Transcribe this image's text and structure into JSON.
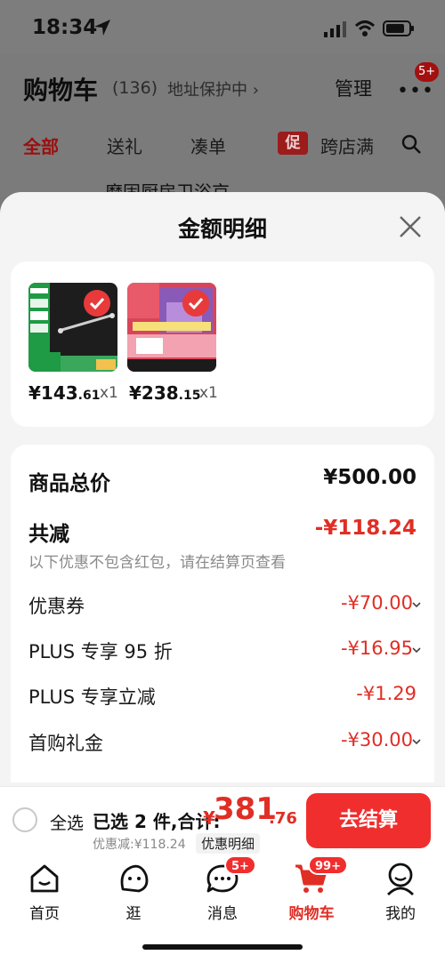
{
  "status_bar": {
    "time": "18:34"
  },
  "cart_header": {
    "title": "购物车",
    "count": "(136)",
    "address_protect": "地址保护中 ›",
    "manage": "管理",
    "more_badge": "5+",
    "tabs": [
      {
        "label": "全部",
        "active": true
      },
      {
        "label": "送礼",
        "active": false
      },
      {
        "label": "凑单",
        "active": false
      },
      {
        "label": "跨店满",
        "active": false
      }
    ],
    "promo_icon": "促",
    "shop_row": "磨固厨房卫浴京"
  },
  "sheet": {
    "title": "金额明细",
    "products": [
      {
        "price_int": "¥143",
        "price_dec": ".61",
        "qty": "x1"
      },
      {
        "price_int": "¥238",
        "price_dec": ".15",
        "qty": "x1"
      }
    ],
    "detail": {
      "total_label": "商品总价",
      "total_value": "¥500.00",
      "reduce_label": "共减",
      "reduce_value": "-¥118.24",
      "reduce_note": "以下优惠不包含红包，请在结算页查看",
      "rows": [
        {
          "label": "优惠券",
          "value": "-¥70.00",
          "chevron": true
        },
        {
          "label": "PLUS 专享 95 折",
          "value": "-¥16.95",
          "chevron": true
        },
        {
          "label": "PLUS 专享立减",
          "value": "-¥1.29",
          "chevron": false
        },
        {
          "label": "首购礼金",
          "value": "-¥30.00",
          "chevron": true
        }
      ]
    }
  },
  "bottom_bar": {
    "select_all": "全选",
    "selected": "已选 2 件,合计:",
    "currency": "¥",
    "total_int": "381",
    "total_dec": ".76",
    "discount_text": "优惠减:¥118.24",
    "discount_detail": "优惠明细",
    "checkout": "去结算"
  },
  "tabbar": {
    "items": [
      {
        "label": "首页",
        "icon": "home-icon",
        "active": false
      },
      {
        "label": "逛",
        "icon": "browse-face-icon",
        "active": false
      },
      {
        "label": "消息",
        "icon": "message-icon",
        "active": false,
        "badge": "5+"
      },
      {
        "label": "购物车",
        "icon": "cart-icon",
        "active": true,
        "badge": "99+"
      },
      {
        "label": "我的",
        "icon": "profile-icon",
        "active": false
      }
    ]
  },
  "colors": {
    "accent": "#e02e24",
    "checkout_bg": "#f02e2e"
  }
}
